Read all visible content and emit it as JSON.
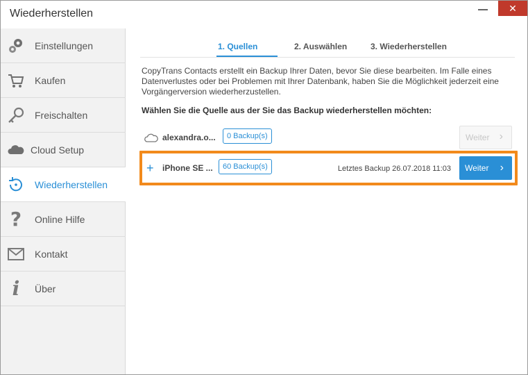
{
  "window": {
    "title": "Wiederherstellen",
    "close_glyph": "✕"
  },
  "sidebar": {
    "items": [
      {
        "label": "Einstellungen",
        "icon": "gears-icon"
      },
      {
        "label": "Kaufen",
        "icon": "cart-icon"
      },
      {
        "label": "Freischalten",
        "icon": "key-icon"
      },
      {
        "label": "Cloud Setup",
        "icon": "cloud-icon"
      },
      {
        "label": "Wiederherstellen",
        "icon": "restore-icon",
        "active": true
      },
      {
        "label": "Online Hilfe",
        "icon": "question-icon"
      },
      {
        "label": "Kontakt",
        "icon": "envelope-icon"
      },
      {
        "label": "Über",
        "icon": "info-icon"
      }
    ]
  },
  "steps": [
    {
      "label": "1. Quellen",
      "active": true
    },
    {
      "label": "2. Auswählen"
    },
    {
      "label": "3. Wiederherstellen"
    }
  ],
  "description": "CopyTrans Contacts erstellt ein Backup Ihrer Daten, bevor Sie diese bearbeiten. Im Falle eines Datenverlustes oder bei Problemen mit Ihrer Datenbank, haben Sie die Möglichkeit jederzeit eine Vorgängerversion wiederherzustellen.",
  "prompt": "Wählen Sie die Quelle aus der Sie das Backup wiederherstellen möchten:",
  "sources": [
    {
      "name": "alexandra.o...",
      "badge": "0 Backup(s)",
      "last_backup": "",
      "button": "Weiter",
      "button_enabled": false,
      "icon": "cloud-icon"
    },
    {
      "name": "iPhone SE ...",
      "badge": "60 Backup(s)",
      "last_backup": "Letztes Backup 26.07.2018 11:03",
      "button": "Weiter",
      "button_enabled": true,
      "icon": "plus-icon",
      "highlighted": true
    }
  ],
  "colors": {
    "accent": "#2a8fd6",
    "highlight": "#f28a1c",
    "close": "#c0392b"
  }
}
